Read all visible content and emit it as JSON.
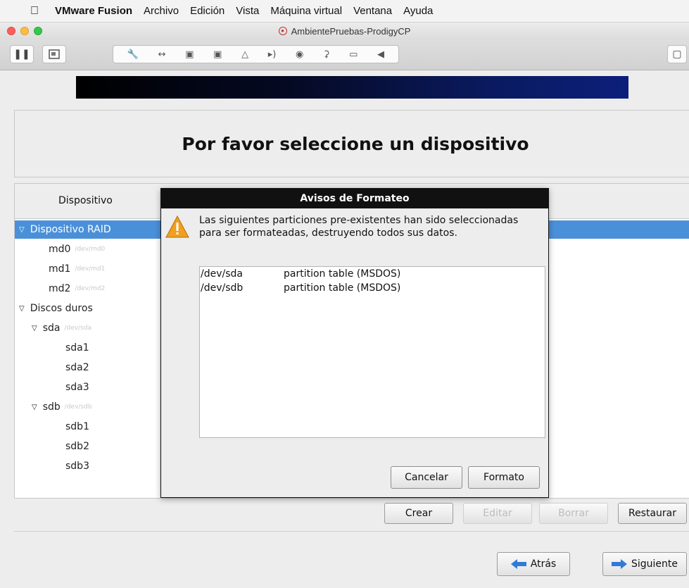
{
  "menubar": {
    "app_name": "VMware Fusion",
    "items": [
      "Archivo",
      "Edición",
      "Vista",
      "Máquina virtual",
      "Ventana",
      "Ayuda"
    ]
  },
  "window": {
    "title": "AmbientePruebas-ProdigyCP"
  },
  "toolbar": {
    "pause_icon": "pause-icon",
    "snapshot_icon": "snapshot-icon"
  },
  "installer": {
    "heading": "Por favor seleccione un dispositivo",
    "column_header": "Dispositivo",
    "tree": [
      {
        "label": "Dispositivo RAID",
        "path": "",
        "level": 0,
        "expandable": true,
        "selected": true
      },
      {
        "label": "md0",
        "path": "/dev/md0",
        "level": 1,
        "expandable": false,
        "selected": false
      },
      {
        "label": "md1",
        "path": "/dev/md1",
        "level": 1,
        "expandable": false,
        "selected": false
      },
      {
        "label": "md2",
        "path": "/dev/md2",
        "level": 1,
        "expandable": false,
        "selected": false
      },
      {
        "label": "Discos duros",
        "path": "",
        "level": 0,
        "expandable": true,
        "selected": false
      },
      {
        "label": "sda",
        "path": "/dev/sda",
        "level": 1,
        "expandable": true,
        "selected": false
      },
      {
        "label": "sda1",
        "path": "",
        "level": 2,
        "expandable": false,
        "selected": false
      },
      {
        "label": "sda2",
        "path": "",
        "level": 2,
        "expandable": false,
        "selected": false
      },
      {
        "label": "sda3",
        "path": "",
        "level": 2,
        "expandable": false,
        "selected": false
      },
      {
        "label": "sdb",
        "path": "/dev/sdb",
        "level": 1,
        "expandable": true,
        "selected": false
      },
      {
        "label": "sdb1",
        "path": "",
        "level": 2,
        "expandable": false,
        "selected": false
      },
      {
        "label": "sdb2",
        "path": "",
        "level": 2,
        "expandable": false,
        "selected": false
      },
      {
        "label": "sdb3",
        "path": "",
        "level": 2,
        "expandable": false,
        "selected": false
      }
    ],
    "buttons": {
      "create": "Crear",
      "edit": "Editar",
      "delete": "Borrar",
      "restore": "Restaurar",
      "back": "Atrás",
      "next": "Siguiente"
    }
  },
  "dialog": {
    "title": "Avisos de Formateo",
    "message": "Las siguientes particiones pre-existentes han sido seleccionadas para ser formateadas, destruyendo todos sus datos.",
    "rows": [
      {
        "device": "/dev/sda",
        "description": "partition table (MSDOS)"
      },
      {
        "device": "/dev/sdb",
        "description": "partition table (MSDOS)"
      }
    ],
    "cancel_label": "Cancelar",
    "format_label": "Formato"
  },
  "colors": {
    "selection": "#4a90d9",
    "dialog_title_bg": "#111111",
    "warning": "#f0a020"
  }
}
